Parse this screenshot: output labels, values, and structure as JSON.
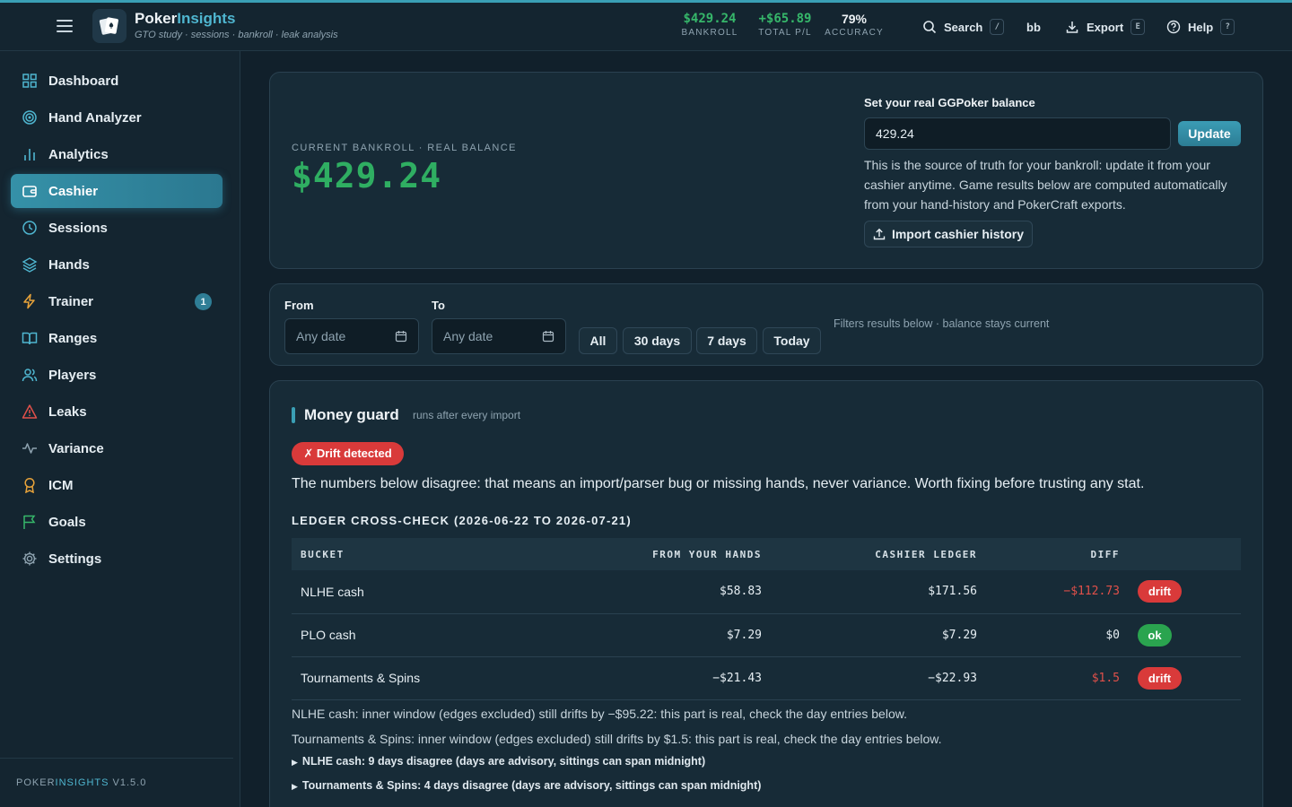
{
  "brand": {
    "name_a": "Poker",
    "name_b": "Insights",
    "subtitle": "GTO study · sessions · bankroll · leak analysis"
  },
  "topbar": {
    "stats": [
      {
        "value": "$429.24",
        "label": "BANKROLL",
        "color": "#36b76a"
      },
      {
        "value": "+$65.89",
        "label": "TOTAL P/L",
        "color": "#36b76a"
      },
      {
        "value": "79%",
        "label": "ACCURACY",
        "color": "#eef3f6"
      }
    ],
    "search_label": "Search",
    "search_key": "/",
    "unit_label": "bb",
    "export_label": "Export",
    "export_key": "E",
    "help_label": "Help",
    "help_key": "?"
  },
  "sidebar": {
    "items": [
      {
        "label": "Dashboard",
        "icon": "grid-icon"
      },
      {
        "label": "Hand Analyzer",
        "icon": "target-icon"
      },
      {
        "label": "Analytics",
        "icon": "bar-chart-icon"
      },
      {
        "label": "Cashier",
        "icon": "wallet-icon",
        "active": true
      },
      {
        "label": "Sessions",
        "icon": "clock-icon"
      },
      {
        "label": "Hands",
        "icon": "layers-icon"
      },
      {
        "label": "Trainer",
        "icon": "bolt-icon",
        "badge": "1"
      },
      {
        "label": "Ranges",
        "icon": "book-icon"
      },
      {
        "label": "Players",
        "icon": "users-icon"
      },
      {
        "label": "Leaks",
        "icon": "warning-icon"
      },
      {
        "label": "Variance",
        "icon": "pulse-icon"
      },
      {
        "label": "ICM",
        "icon": "award-icon"
      },
      {
        "label": "Goals",
        "icon": "flag-icon"
      },
      {
        "label": "Settings",
        "icon": "gear-icon"
      }
    ],
    "footer_a": "POKER",
    "footer_b": "INSIGHTS",
    "footer_c": " V1.5.0"
  },
  "bankroll": {
    "kicker": "CURRENT BANKROLL · REAL BALANCE",
    "value": "$429.24",
    "set_label": "Set your real GGPoker balance",
    "input_value": "429.24",
    "update_label": "Update",
    "description": "This is the source of truth for your bankroll: update it from your cashier anytime. Game results below are computed automatically from your hand-history and PokerCraft exports.",
    "import_label": "Import cashier history"
  },
  "filters": {
    "from_label": "From",
    "to_label": "To",
    "from_placeholder": "Any date",
    "to_placeholder": "Any date",
    "presets": [
      "All",
      "30 days",
      "7 days",
      "Today"
    ],
    "hint": "Filters results below · balance stays current"
  },
  "guard": {
    "title": "Money guard",
    "subtitle": "runs after every import",
    "status": "✗ Drift detected",
    "message": "The numbers below disagree: that means an import/parser bug or missing hands, never variance. Worth fixing before trusting any stat.",
    "section_title": "LEDGER CROSS-CHECK (2026-06-22 TO 2026-07-21)",
    "columns": [
      "BUCKET",
      "FROM YOUR HANDS",
      "CASHIER LEDGER",
      "DIFF"
    ],
    "rows": [
      {
        "bucket": "NLHE cash",
        "hands": "$58.83",
        "ledger": "$171.56",
        "diff": "−$112.73",
        "status": "drift"
      },
      {
        "bucket": "PLO cash",
        "hands": "$7.29",
        "ledger": "$7.29",
        "diff": "$0",
        "status": "ok"
      },
      {
        "bucket": "Tournaments & Spins",
        "hands": "−$21.43",
        "ledger": "−$22.93",
        "diff": "$1.5",
        "status": "drift"
      }
    ],
    "notes": [
      "NLHE cash: inner window (edges excluded) still drifts by −$95.22: this part is real, check the day entries below.",
      "Tournaments & Spins: inner window (edges excluded) still drifts by $1.5: this part is real, check the day entries below."
    ],
    "details": [
      "NLHE cash: 9 days disagree (days are advisory, sittings can span midnight)",
      "Tournaments & Spins: 4 days disagree (days are advisory, sittings can span midnight)"
    ]
  }
}
